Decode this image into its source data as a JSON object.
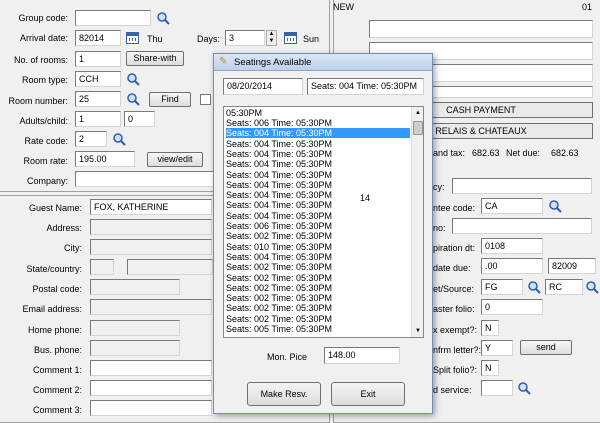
{
  "left": {
    "group_code_label": "Group code:",
    "arrival_label": "Arrival date:",
    "arrival_value": "82014",
    "arrival_day": "Thu",
    "days_label": "Days:",
    "days_value": "3",
    "departure_day": "Sun",
    "rooms_label": "No. of rooms:",
    "rooms_value": "1",
    "share_button": "Share-with",
    "room_type_label": "Room type:",
    "room_type_value": "CCH",
    "room_number_label": "Room number:",
    "room_number_value": "25",
    "find_button": "Find",
    "adults_label": "Adults/child:",
    "adults_value": "1",
    "child_value": "0",
    "rate_code_label": "Rate code:",
    "rate_code_value": "2",
    "room_rate_label": "Room rate:",
    "room_rate_value": "195.00",
    "view_edit_button": "view/edit",
    "company_label": "Company:",
    "guest_name_label": "Guest Name:",
    "guest_name_value": "FOX, KATHERINE",
    "address_label": "Address:",
    "city_label": "City:",
    "state_label": "State/country:",
    "postal_label": "Postal code:",
    "email_label": "Email address:",
    "home_phone_label": "Home phone:",
    "bus_phone_label": "Bus. phone:",
    "comment1_label": "Comment 1:",
    "comment2_label": "Comment 2:",
    "comment3_label": "Comment 3:"
  },
  "right": {
    "status": "NEW",
    "number": "01",
    "payment_button": "CASH PAYMENT",
    "relais_button": "RELAIS & CHATEAUX",
    "tax_label": "and tax:",
    "tax_value": "682.63",
    "net_due_label": "Net due:",
    "net_due_value": "682.63",
    "agency_label": "cy:",
    "guarantee_label": "ntee code:",
    "guarantee_value": "CA",
    "cc_label": "no:",
    "expiration_label": "piration dt:",
    "expiration_value": "0108",
    "date_due_label": "date due:",
    "date_due_value": ".00",
    "date_due_value2": "82009",
    "source_label": "et/Source:",
    "source_value": "FG",
    "source_value2": "RC",
    "master_label": "aster folio:",
    "master_value": "0",
    "tax_exempt_label": "x exempt?:",
    "tax_exempt_value": "N",
    "confirm_label": "nfrm letter?:",
    "confirm_value": "Y",
    "send_button": "send",
    "split_label": "Split folio?:",
    "split_value": "N",
    "service_label": "d service:"
  },
  "dialog": {
    "title": "Seatings Available",
    "date": "08/20/2014",
    "seats_summary": "Seats: 004   Time: 05:30PM",
    "list_header": "05:30PM",
    "rows": [
      "Seats: 006   Time: 05:30PM",
      "Seats: 004   Time: 05:30PM",
      "Seats: 004   Time: 05:30PM",
      "Seats: 004   Time: 05:30PM",
      "Seats: 004   Time: 05:30PM",
      "Seats: 004   Time: 05:30PM",
      "Seats: 004   Time: 05:30PM",
      "Seats: 004   Time: 05:30PM",
      "Seats: 004   Time: 05:30PM",
      "Seats: 004   Time: 05:30PM",
      "Seats: 006   Time: 05:30PM",
      "Seats: 002   Time: 05:30PM",
      "Seats: 010   Time: 05:30PM",
      "Seats: 004   Time: 05:30PM",
      "Seats: 002   Time: 05:30PM",
      "Seats: 002   Time: 05:30PM",
      "Seats: 002   Time: 05:30PM",
      "Seats: 002   Time: 05:30PM",
      "Seats: 002   Time: 05:30PM",
      "Seats: 002   Time: 05:30PM",
      "Seats: 005   Time: 05:30PM"
    ],
    "selected_index": 1,
    "count": "14",
    "mon_price_label": "Mon. Pice",
    "mon_price_value": "148.00",
    "make_button": "Make Resv.",
    "exit_button": "Exit"
  },
  "icons": {
    "search": "magnifier-icon",
    "calendar": "calendar-icon"
  }
}
